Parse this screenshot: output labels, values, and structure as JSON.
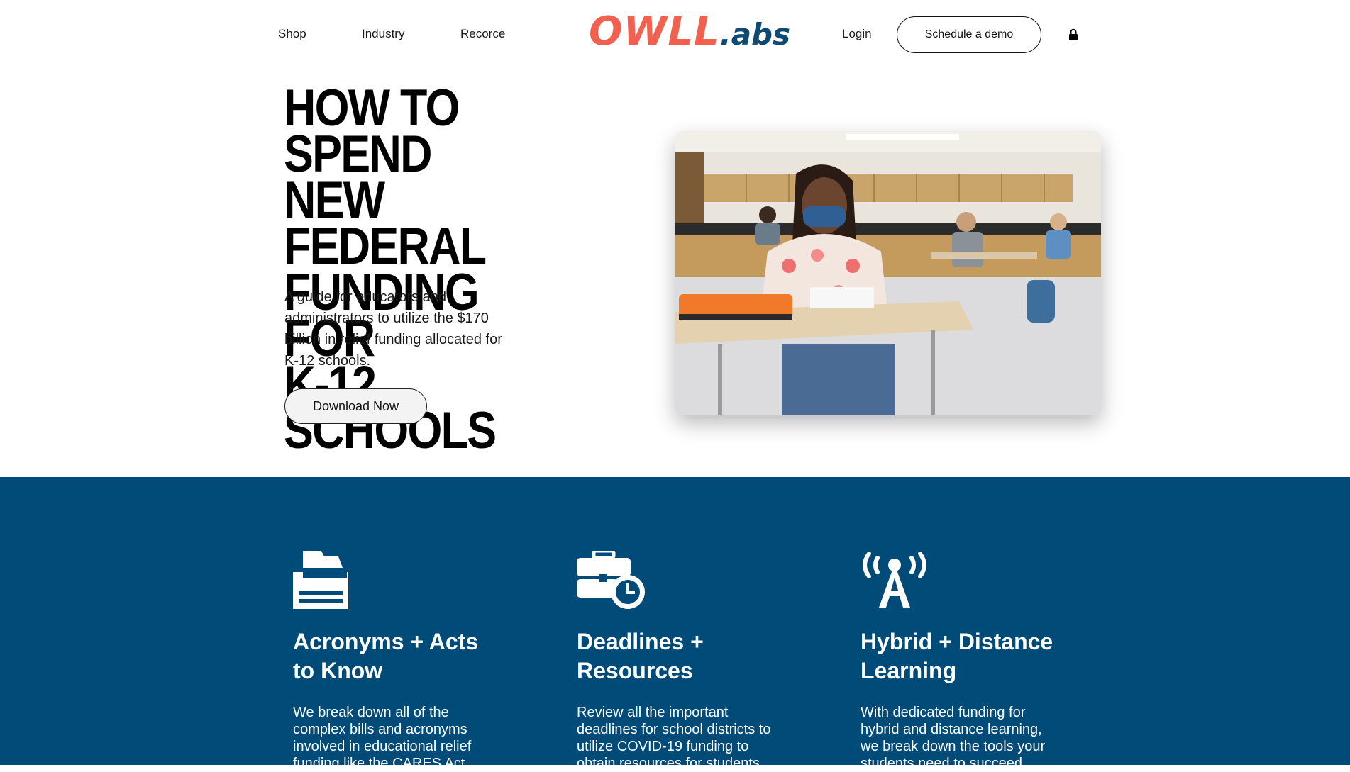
{
  "nav": {
    "shop": "Shop",
    "industry": "Industry",
    "resource": "Recorce",
    "login": "Login",
    "demo": "Schedule a demo"
  },
  "logo": {
    "main": "OWLL",
    "suffix": ".abs",
    "main_color": "#f2604f",
    "suffix_color": "#0e4a72"
  },
  "hero": {
    "title_lines": [
      "HOW TO SPEND",
      "NEW FEDERAL",
      "FUNDING FOR",
      "K-12 SCHOOLS"
    ],
    "subtitle": "A guide for educators and administrators to utilize the $170 billion in relief funding allocated for K-12 schools.",
    "cta": "Download Now"
  },
  "features": [
    {
      "icon": "inbox-tray-icon",
      "title": "Acronyms + Acts to Know",
      "body": "We break down all of the complex bills and acronyms involved in educational relief funding like the CARES Act,"
    },
    {
      "icon": "briefcase-clock-icon",
      "title": "Deadlines + Resources",
      "body": "Review all the important deadlines for school districts to utilize COVID-19 funding to obtain resources for students"
    },
    {
      "icon": "broadcast-tower-icon",
      "title": "Hybrid + Distance Learning",
      "body": "With dedicated funding for hybrid and distance learning, we break down the tools your students need to succeed"
    }
  ],
  "colors": {
    "section_bg": "#004b78",
    "accent": "#f2604f"
  }
}
